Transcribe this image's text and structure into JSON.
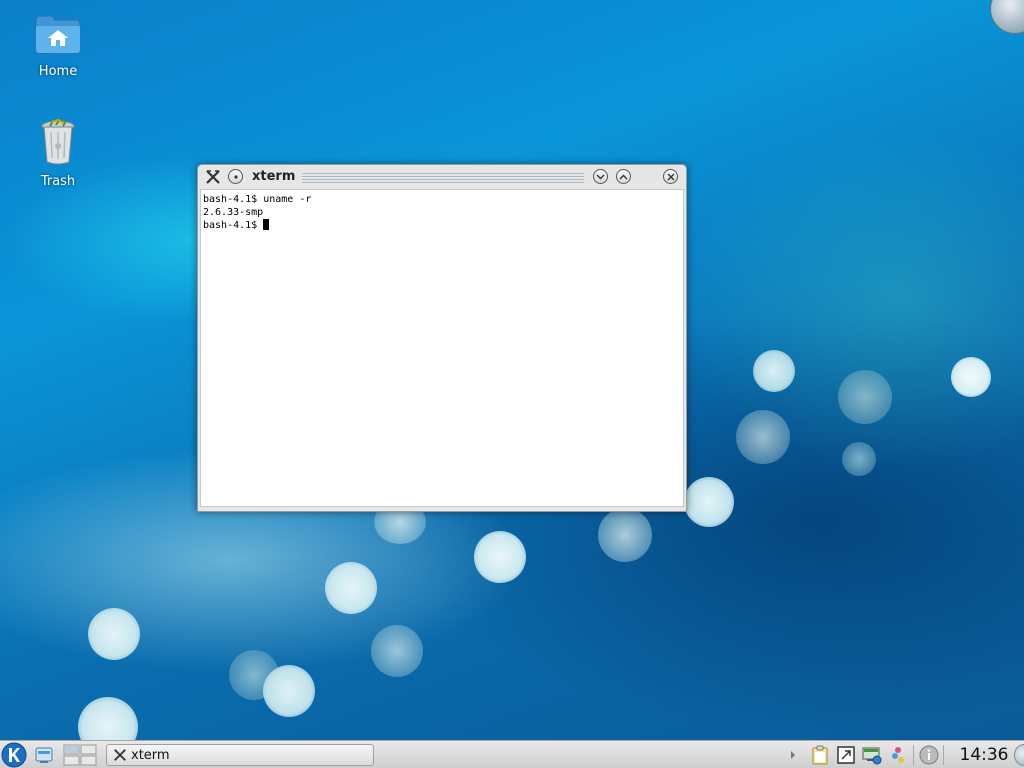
{
  "desktop": {
    "icons": [
      {
        "label": "Home",
        "icon": "folder-home-icon"
      },
      {
        "label": "Trash",
        "icon": "trash-icon"
      }
    ]
  },
  "window": {
    "title": "xterm",
    "app_icon": "xterm-icon",
    "buttons": {
      "menu": "window-menu-icon",
      "minimize": "minimize-icon",
      "maximize": "maximize-icon",
      "close": "close-icon"
    },
    "terminal": {
      "lines": [
        "bash-4.1$ uname -r",
        "2.6.33-smp",
        "bash-4.1$ "
      ]
    }
  },
  "taskbar": {
    "launcher_icon": "kde-kickoff-icon",
    "task": {
      "label": "xterm",
      "icon": "xterm-icon"
    },
    "tray_icons": [
      "clipboard-icon",
      "device-notifier-icon",
      "network-icon",
      "color-icon",
      "info-icon"
    ],
    "clock": "14:36"
  }
}
